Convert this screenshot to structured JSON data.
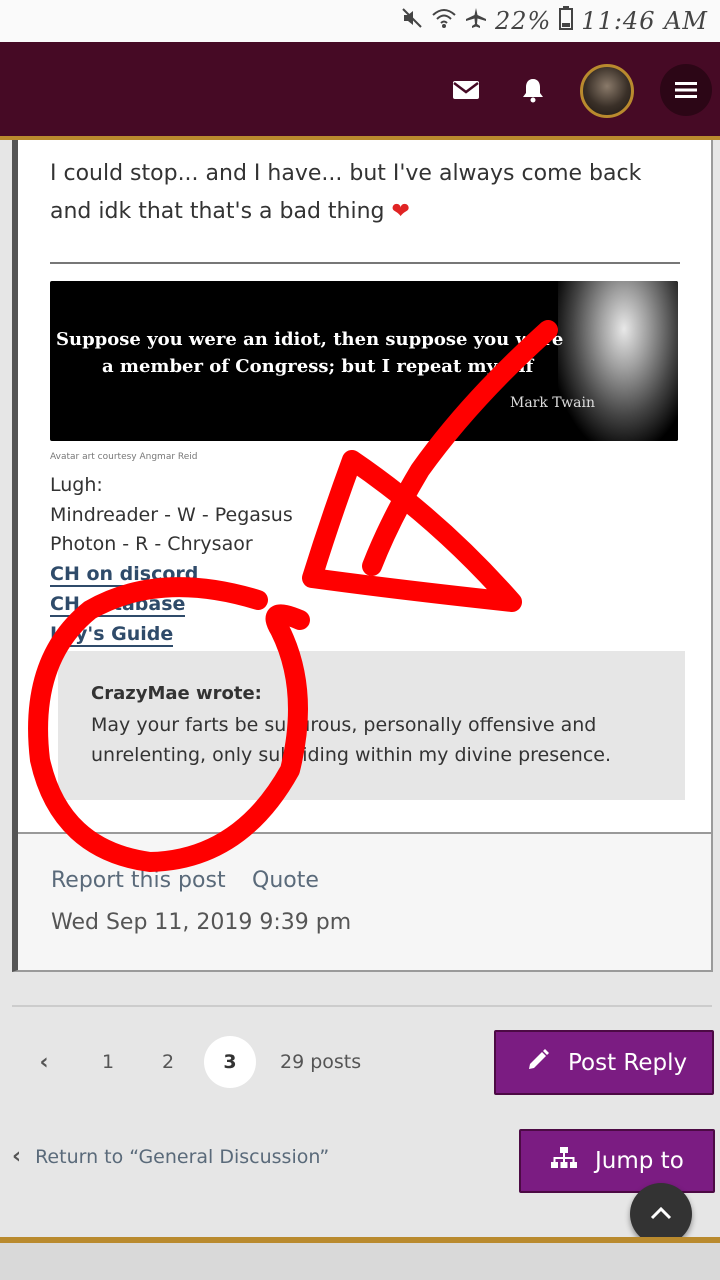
{
  "status_bar": {
    "battery": "22%",
    "time": "11:46 AM",
    "icons": [
      "mute-icon",
      "wifi-icon",
      "airplane-icon",
      "battery-icon"
    ]
  },
  "header": {
    "icons": [
      "mail-icon",
      "bell-icon",
      "avatar",
      "hamburger-menu-icon"
    ]
  },
  "post": {
    "text": "I could stop... and I have... but I've always come back and idk that that's a bad thing",
    "emoji": "❤",
    "signature": {
      "quote_image": {
        "line1": "Suppose you were an idiot, then suppose you were",
        "line2": "a member of Congress; but I repeat myself",
        "author": "Mark Twain"
      },
      "avatar_credit": "Avatar art courtesy Angmar Reid",
      "lines": [
        "Lugh:",
        "Mindreader - W - Pegasus",
        "Photon - R - Chrysaor"
      ],
      "links": [
        "CH on discord",
        "CH database",
        "Ley's Guide"
      ]
    },
    "blockquote": {
      "author": "CrazyMae wrote:",
      "text": "May your farts be sulfurous, personally offensive and unrelenting, only subsiding within my divine presence."
    },
    "footer": {
      "report": "Report this post",
      "quote": "Quote",
      "date": "Wed Sep 11, 2019 9:39 pm"
    }
  },
  "pagination": {
    "prev": "‹",
    "pages": [
      "1",
      "2",
      "3"
    ],
    "current": "3",
    "count": "29 posts"
  },
  "actions": {
    "post_reply": "Post Reply",
    "jump_to": "Jump to",
    "return_link": "Return to “General Discussion”"
  },
  "colors": {
    "header_bg": "#460a25",
    "accent_gold": "#b98a2e",
    "button_purple": "#7b1c82",
    "annotation_red": "#ff0000"
  }
}
